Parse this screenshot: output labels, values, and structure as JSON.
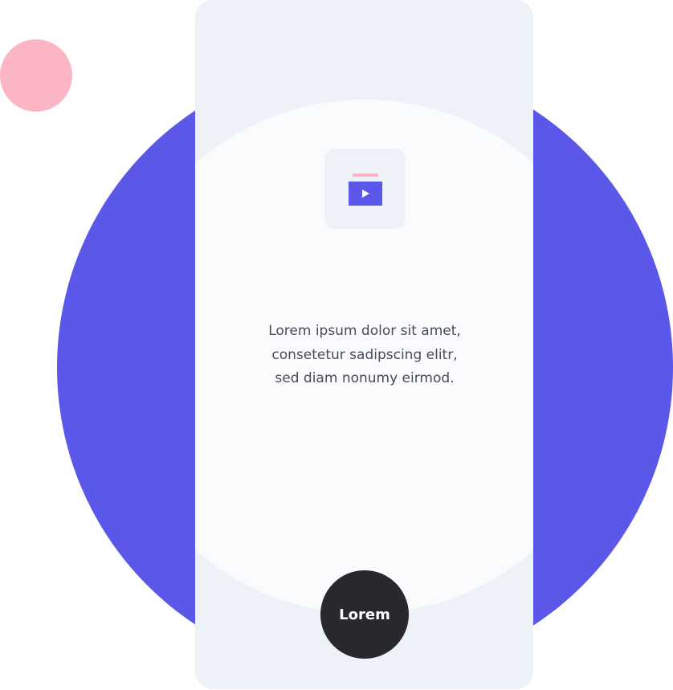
{
  "colors": {
    "accent": "#5b57e8",
    "pink": "#fcb5c3",
    "card": "#edf1f8",
    "button": "#29292d"
  },
  "icon": "video-play-icon",
  "body_text": "Lorem ipsum dolor sit amet, consetetur sadipscing elitr, sed diam nonumy eirmod.",
  "button_label": "Lorem"
}
